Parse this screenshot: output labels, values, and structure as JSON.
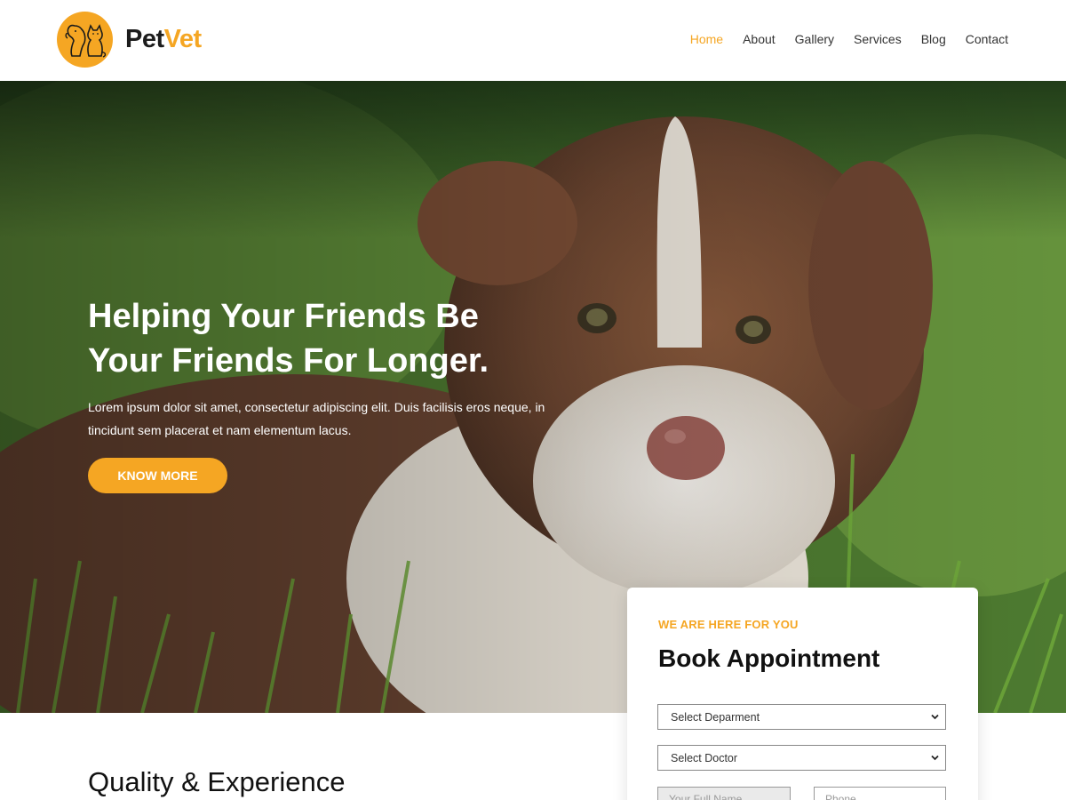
{
  "brand": {
    "name_part1": "Pet",
    "name_part2": "Vet",
    "logo_icon": "dog-cat-icon",
    "accent": "#f5a623"
  },
  "nav": {
    "items": [
      {
        "label": "Home",
        "active": true
      },
      {
        "label": "About",
        "active": false
      },
      {
        "label": "Gallery",
        "active": false
      },
      {
        "label": "Services",
        "active": false
      },
      {
        "label": "Blog",
        "active": false
      },
      {
        "label": "Contact",
        "active": false
      }
    ]
  },
  "hero": {
    "title": "Helping Your Friends Be Your Friends For Longer.",
    "text": "Lorem ipsum dolor sit amet, consectetur adipiscing elit. Duis facilisis eros neque, in tincidunt sem placerat et nam elementum lacus.",
    "button_label": "KNOW MORE"
  },
  "appointment": {
    "eyebrow": "WE ARE HERE FOR YOU",
    "title": "Book Appointment",
    "department_select": "Select Deparment",
    "doctor_select": "Select Doctor",
    "name_placeholder": "Your Full Name",
    "phone_placeholder": "Phone"
  },
  "section": {
    "title": "Quality & Experience"
  }
}
